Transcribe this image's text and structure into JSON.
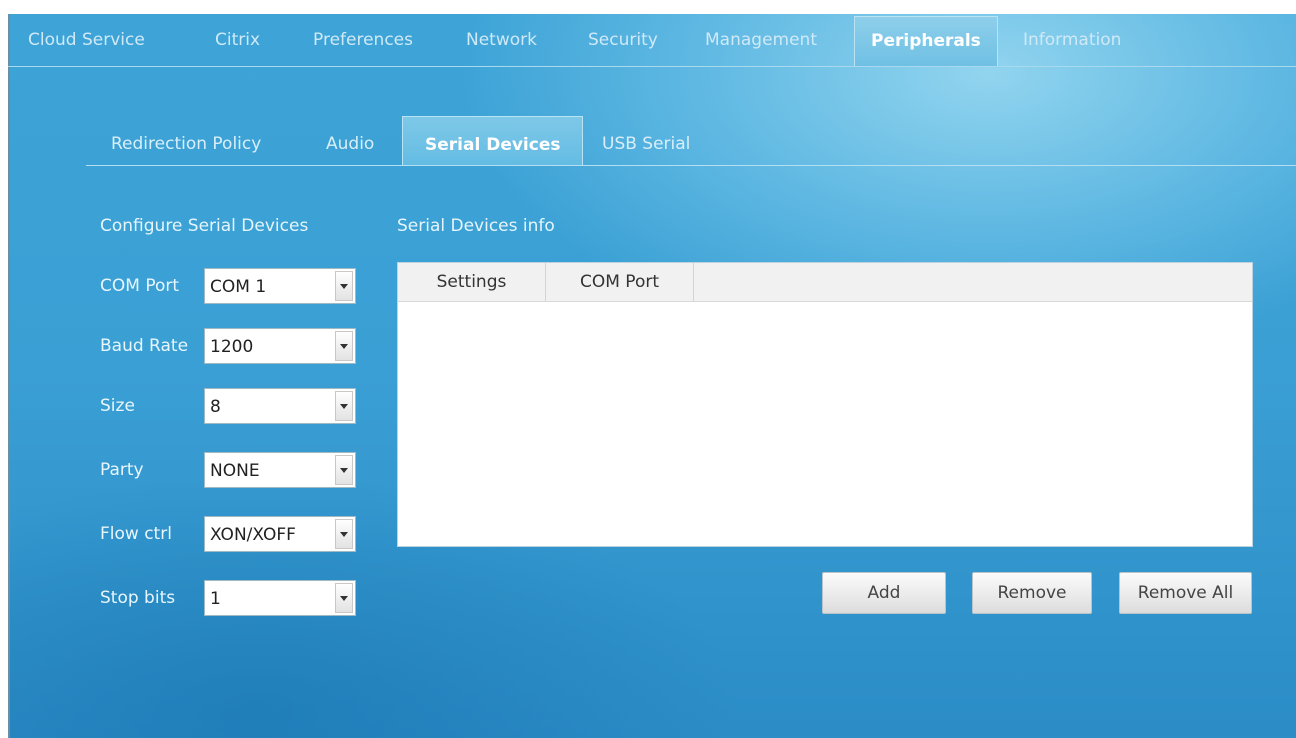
{
  "top_tabs": [
    {
      "label": "Cloud Service"
    },
    {
      "label": "Citrix"
    },
    {
      "label": "Preferences"
    },
    {
      "label": "Network"
    },
    {
      "label": "Security"
    },
    {
      "label": "Management"
    },
    {
      "label": "Peripherals",
      "active": true
    },
    {
      "label": "Information"
    }
  ],
  "sub_tabs": [
    {
      "label": "Redirection Policy"
    },
    {
      "label": "Audio"
    },
    {
      "label": "Serial Devices",
      "active": true
    },
    {
      "label": "USB Serial"
    }
  ],
  "config": {
    "title": "Configure Serial Devices",
    "fields": [
      {
        "label": "COM Port",
        "value": "COM 1"
      },
      {
        "label": "Baud Rate",
        "value": "1200"
      },
      {
        "label": "Size",
        "value": "8"
      },
      {
        "label": "Party",
        "value": "NONE"
      },
      {
        "label": "Flow ctrl",
        "value": "XON/XOFF"
      },
      {
        "label": "Stop bits",
        "value": "1"
      }
    ]
  },
  "info": {
    "title": "Serial Devices info",
    "columns": [
      "Settings",
      "COM Port"
    ],
    "rows": []
  },
  "buttons": {
    "add": "Add",
    "remove": "Remove",
    "remove_all": "Remove All"
  },
  "icons": {
    "dropdown": "chevron-down-icon"
  },
  "colors": {
    "background": "#3ea4d7",
    "active_tab": "#7ec8e8"
  }
}
